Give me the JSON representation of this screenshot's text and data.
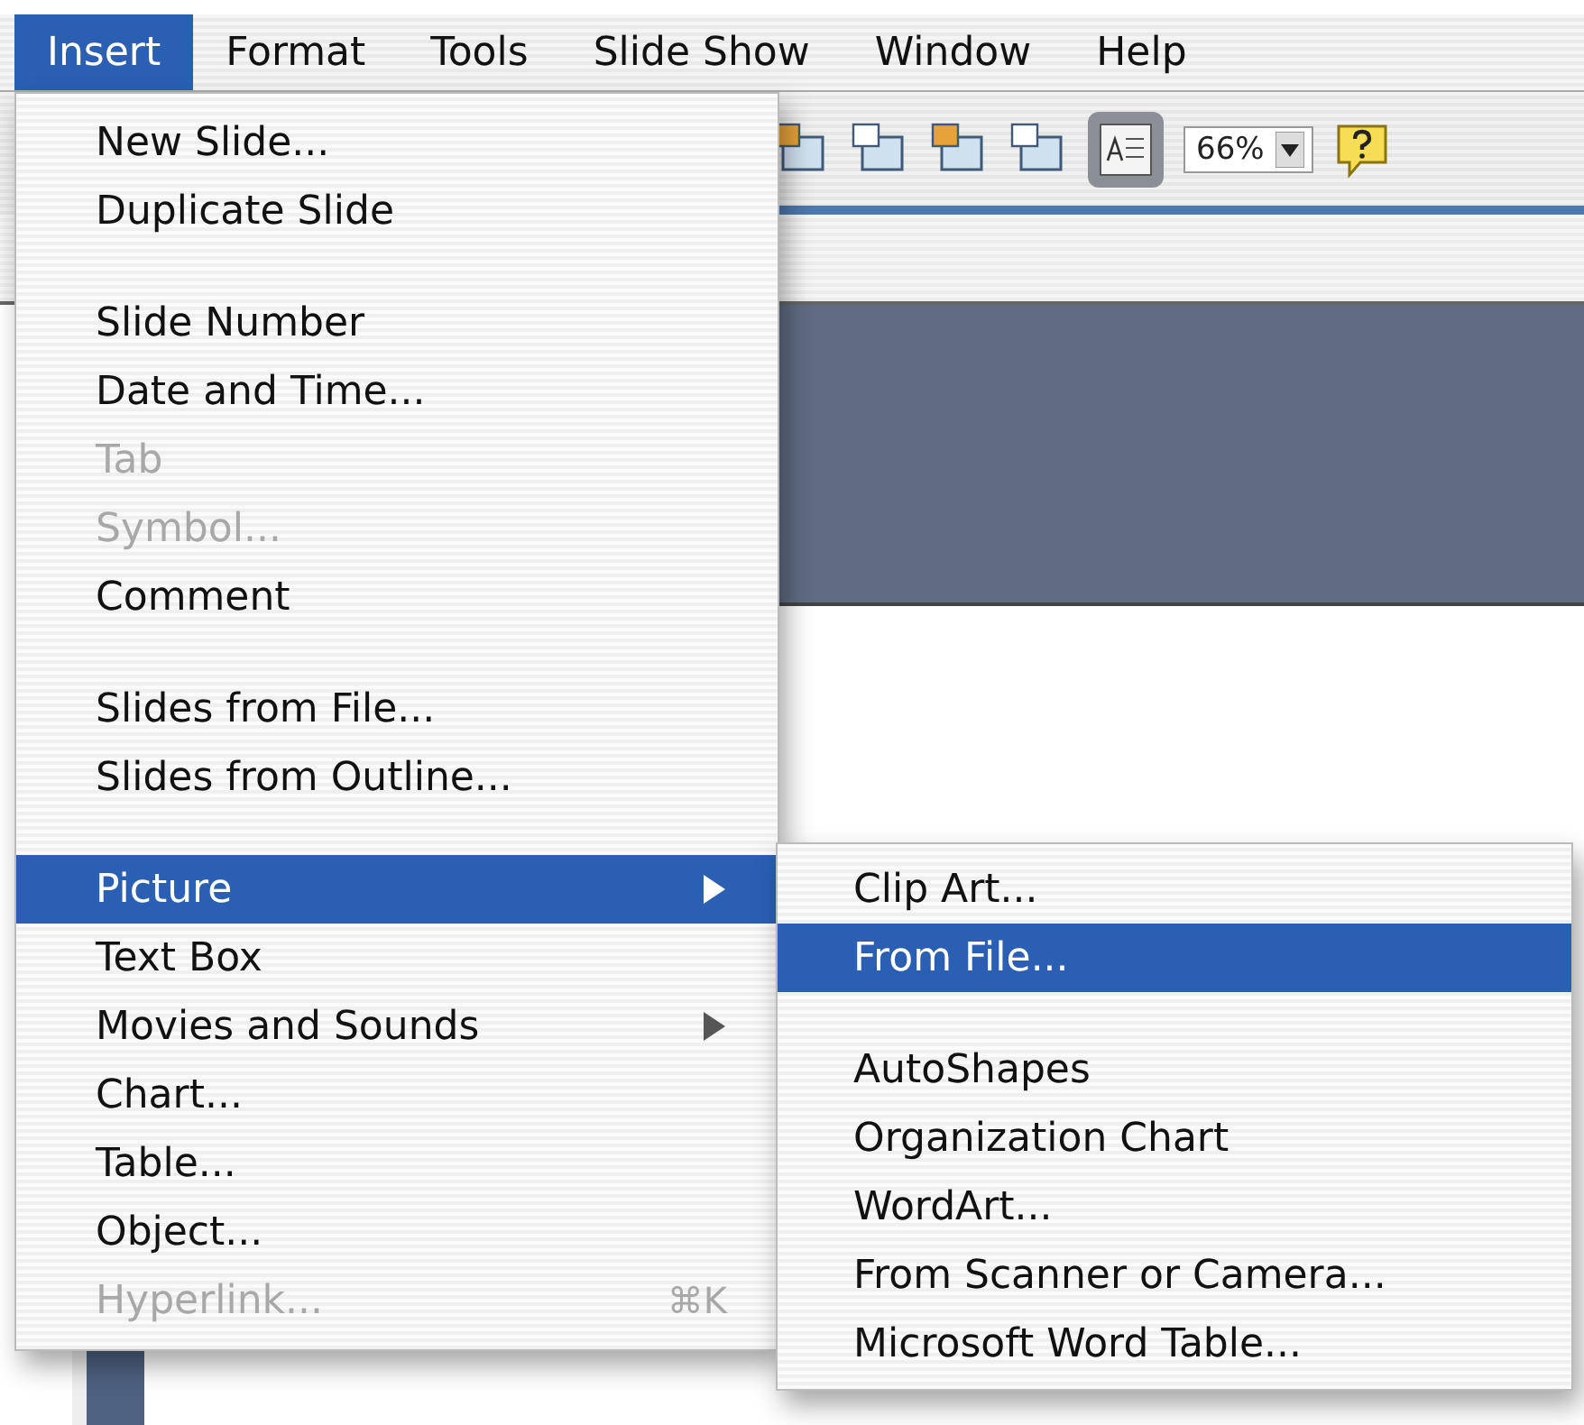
{
  "menu_bar": [
    {
      "label": "Insert",
      "selected": true
    },
    {
      "label": "Format",
      "selected": false
    },
    {
      "label": "Tools",
      "selected": false
    },
    {
      "label": "Slide Show",
      "selected": false
    },
    {
      "label": "Window",
      "selected": false
    },
    {
      "label": "Help",
      "selected": false
    }
  ],
  "toolbar": {
    "zoom": "66%"
  },
  "insert_menu": [
    {
      "kind": "item",
      "label": "New Slide...",
      "disabled": false,
      "selected": false
    },
    {
      "kind": "item",
      "label": "Duplicate Slide",
      "disabled": false,
      "selected": false
    },
    {
      "kind": "separator"
    },
    {
      "kind": "item",
      "label": "Slide Number",
      "disabled": false,
      "selected": false
    },
    {
      "kind": "item",
      "label": "Date and Time...",
      "disabled": false,
      "selected": false
    },
    {
      "kind": "item",
      "label": "Tab",
      "disabled": true,
      "selected": false
    },
    {
      "kind": "item",
      "label": "Symbol...",
      "disabled": true,
      "selected": false
    },
    {
      "kind": "item",
      "label": "Comment",
      "disabled": false,
      "selected": false
    },
    {
      "kind": "separator"
    },
    {
      "kind": "item",
      "label": "Slides from File...",
      "disabled": false,
      "selected": false
    },
    {
      "kind": "item",
      "label": "Slides from Outline...",
      "disabled": false,
      "selected": false
    },
    {
      "kind": "separator"
    },
    {
      "kind": "submenu",
      "label": "Picture",
      "disabled": false,
      "selected": true
    },
    {
      "kind": "item",
      "label": "Text Box",
      "disabled": false,
      "selected": false
    },
    {
      "kind": "submenu",
      "label": "Movies and Sounds",
      "disabled": false,
      "selected": false
    },
    {
      "kind": "item",
      "label": "Chart...",
      "disabled": false,
      "selected": false
    },
    {
      "kind": "item",
      "label": "Table...",
      "disabled": false,
      "selected": false
    },
    {
      "kind": "item",
      "label": "Object...",
      "disabled": false,
      "selected": false
    },
    {
      "kind": "item",
      "label": "Hyperlink...",
      "disabled": true,
      "selected": false,
      "shortcut": "⌘K"
    }
  ],
  "picture_submenu": [
    {
      "kind": "item",
      "label": "Clip Art...",
      "selected": false
    },
    {
      "kind": "item",
      "label": "From File...",
      "selected": true
    },
    {
      "kind": "separator"
    },
    {
      "kind": "item",
      "label": "AutoShapes",
      "selected": false
    },
    {
      "kind": "item",
      "label": "Organization Chart",
      "selected": false
    },
    {
      "kind": "item",
      "label": "WordArt...",
      "selected": false
    },
    {
      "kind": "item",
      "label": "From Scanner or Camera...",
      "selected": false
    },
    {
      "kind": "item",
      "label": "Microsoft Word Table...",
      "selected": false
    }
  ]
}
